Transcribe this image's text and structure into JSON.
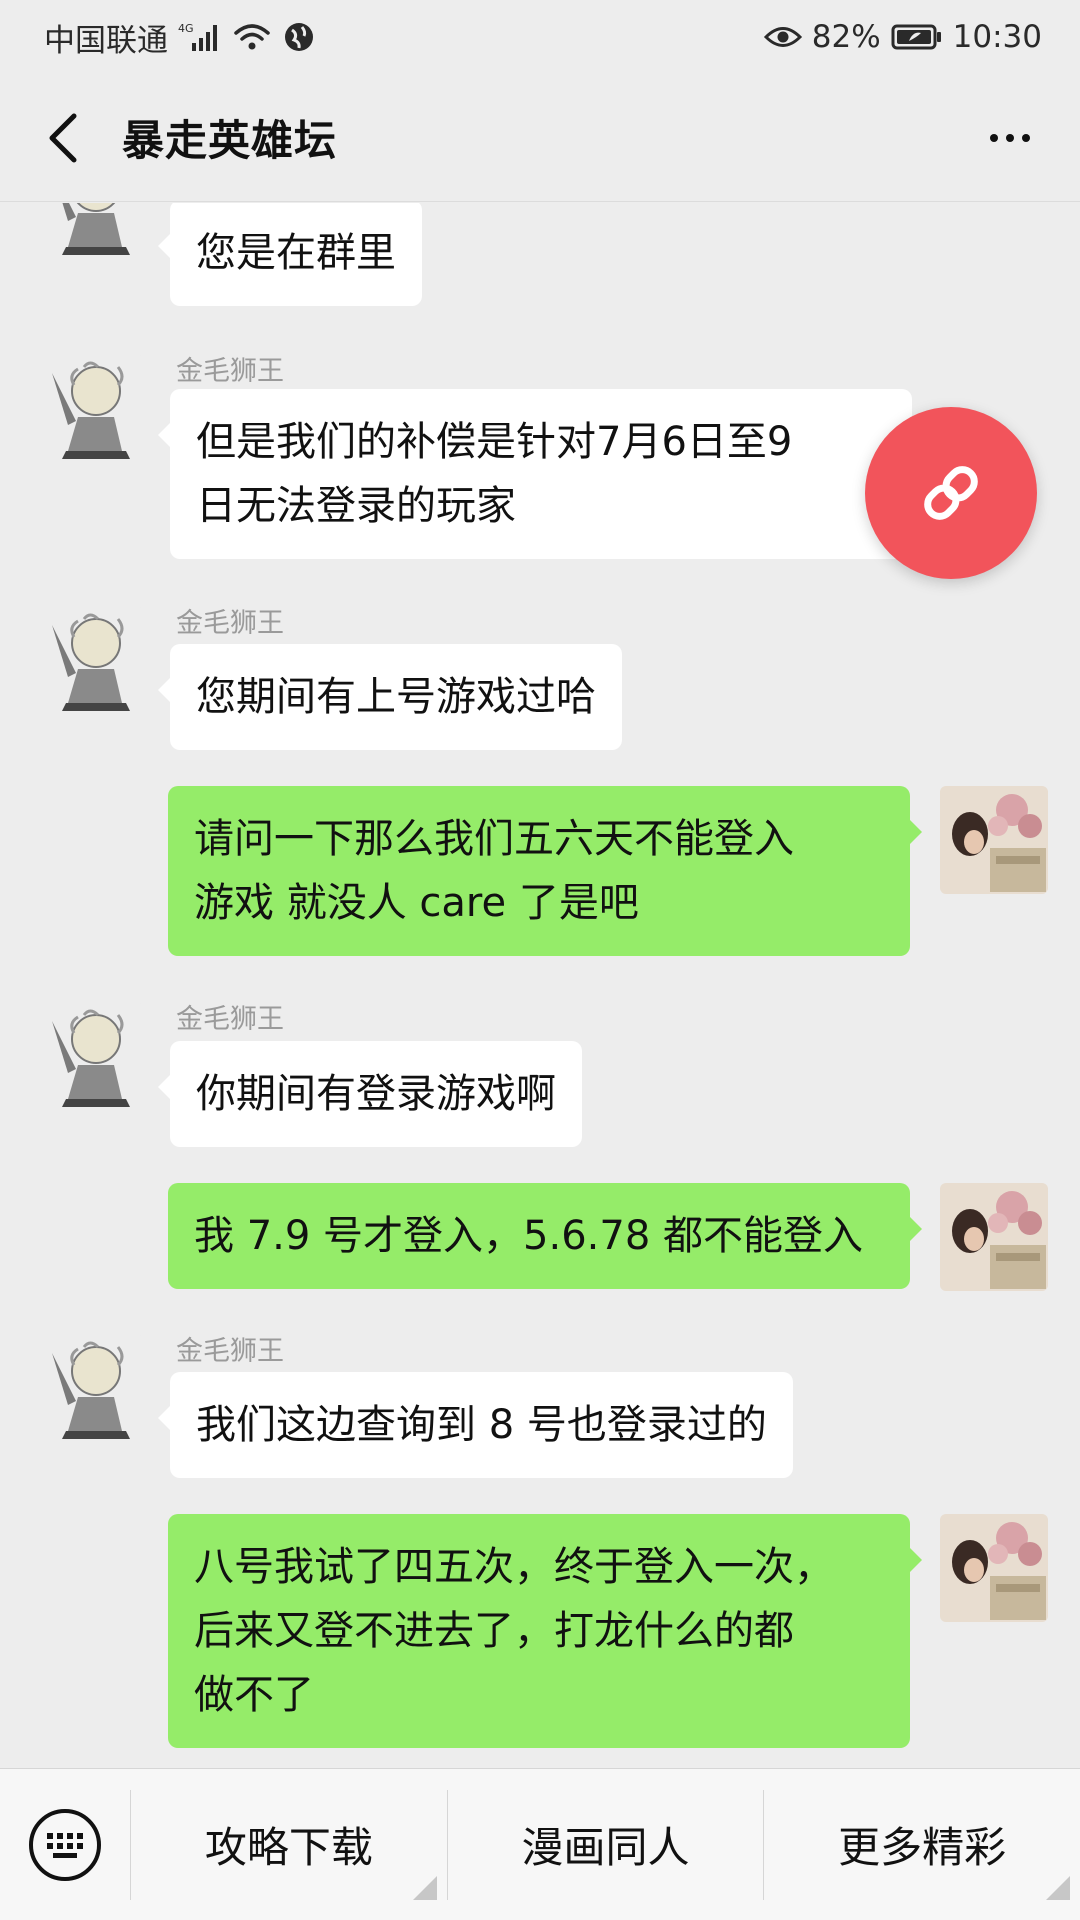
{
  "status_bar": {
    "carrier": "中国联通",
    "network": "4G",
    "battery": "82%",
    "time": "10:30"
  },
  "header": {
    "title": "暴走英雄坛"
  },
  "messages": [
    {
      "direction": "in",
      "sender": "",
      "text": "您是在群里"
    },
    {
      "direction": "in",
      "sender": "金毛狮王",
      "text": "但是我们的补偿是针对7月6日至9\n日无法登录的玩家"
    },
    {
      "direction": "in",
      "sender": "金毛狮王",
      "text": "您期间有上号游戏过哈"
    },
    {
      "direction": "out",
      "sender": "",
      "text": "请问一下那么我们五六天不能登入\n游戏 就没人 care 了是吧"
    },
    {
      "direction": "in",
      "sender": "金毛狮王",
      "text": "你期间有登录游戏啊"
    },
    {
      "direction": "out",
      "sender": "",
      "text": "我 7.9 号才登入，5.6.78 都不能登入"
    },
    {
      "direction": "in",
      "sender": "金毛狮王",
      "text": "我们这边查询到 8 号也登录过的"
    },
    {
      "direction": "out",
      "sender": "",
      "text": "八号我试了四五次，终于登入一次，\n后来又登不进去了，打龙什么的都\n做不了"
    }
  ],
  "bottom_menu": {
    "items": [
      {
        "label": "攻略下载"
      },
      {
        "label": "漫画同人"
      },
      {
        "label": "更多精彩"
      }
    ]
  },
  "colors": {
    "background": "#ededed",
    "incoming_bubble": "#ffffff",
    "outgoing_bubble": "#95ec69",
    "float_button": "#f2545b",
    "sender_name": "#9a9a9a"
  }
}
